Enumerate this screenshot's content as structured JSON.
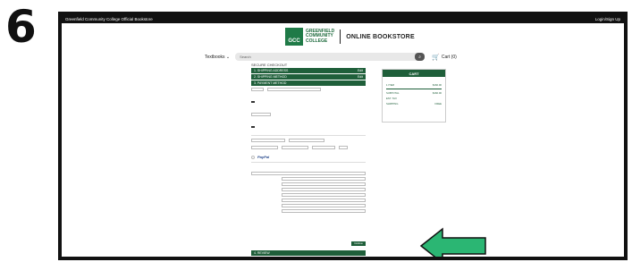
{
  "step_number": "6",
  "topbar": {
    "site_name": "Greenfield Community College Official Bookstore",
    "login_label": "Login/Sign Up"
  },
  "brand": {
    "logo_letters": "GCC",
    "logo_line1": "GREENFIELD",
    "logo_line2": "COMMUNITY",
    "logo_line3": "COLLEGE",
    "store_name": "ONLINE BOOKSTORE"
  },
  "nav": {
    "textbooks_label": "Textbooks",
    "search_placeholder": "Search",
    "cart_label": "Cart (0)"
  },
  "checkout": {
    "title": "SECURE CHECKOUT",
    "sections": [
      {
        "label": "1. SHIPPING ADDRESS",
        "action": "Edit"
      },
      {
        "label": "2. SHIPPING METHOD",
        "action": "Edit"
      },
      {
        "label": "3. PAYMENT METHOD",
        "action": ""
      }
    ],
    "continue_label": "Continue",
    "review_label": "4. REVIEW"
  },
  "cart": {
    "title": "CART",
    "lines": [
      {
        "label": "1 ITEM",
        "value": "$160.00"
      },
      {
        "label": "SUBTOTAL",
        "value": "$160.00"
      },
      {
        "label": "EST. TAX",
        "value": ""
      },
      {
        "label": "SHIPPING",
        "value": "FREE"
      }
    ]
  },
  "colors": {
    "brand_green": "#1f5f3a",
    "arrow_green": "#2bb673"
  }
}
